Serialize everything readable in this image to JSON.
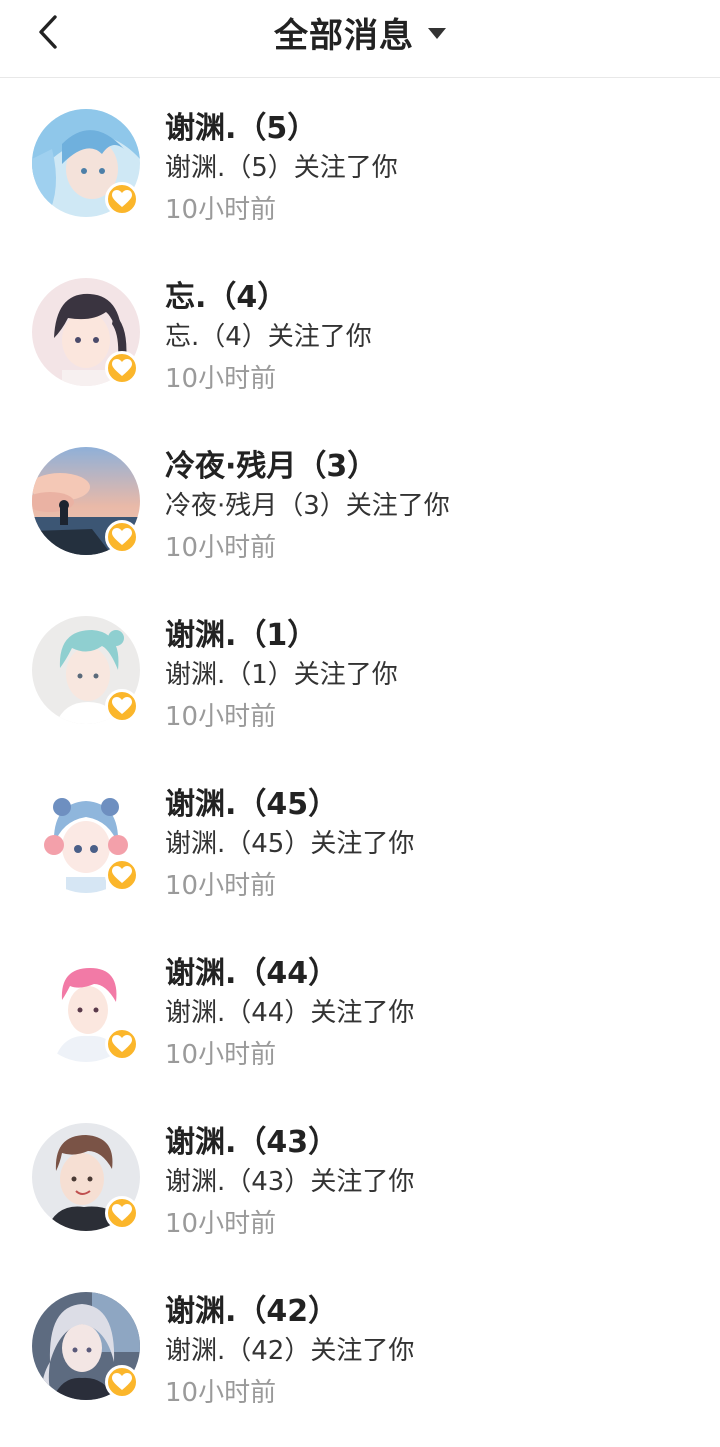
{
  "header": {
    "title": "全部消息"
  },
  "accent_color": "#fbb62b",
  "messages": [
    {
      "name": "谢渊.（5）",
      "text": "谢渊.（5）关注了你",
      "time": "10小时前",
      "avatar": "avatar-blue-hair-girl"
    },
    {
      "name": "忘.（4）",
      "text": "忘.（4）关注了你",
      "time": "10小时前",
      "avatar": "avatar-dark-hair-girl"
    },
    {
      "name": "冷夜·残月（3）",
      "text": "冷夜·残月（3）关注了你",
      "time": "10小时前",
      "avatar": "avatar-sunset-sea"
    },
    {
      "name": "谢渊.（1）",
      "text": "谢渊.（1）关注了你",
      "time": "10小时前",
      "avatar": "avatar-mint-hair-boy"
    },
    {
      "name": "谢渊.（45）",
      "text": "谢渊.（45）关注了你",
      "time": "10小时前",
      "avatar": "avatar-headphone-girl"
    },
    {
      "name": "谢渊.（44）",
      "text": "谢渊.（44）关注了你",
      "time": "10小时前",
      "avatar": "avatar-pink-hair-boy"
    },
    {
      "name": "谢渊.（43）",
      "text": "谢渊.（43）关注了你",
      "time": "10小时前",
      "avatar": "avatar-brown-hair-boy"
    },
    {
      "name": "谢渊.（42）",
      "text": "谢渊.（42）关注了你",
      "time": "10小时前",
      "avatar": "avatar-silver-hair-girl"
    }
  ]
}
